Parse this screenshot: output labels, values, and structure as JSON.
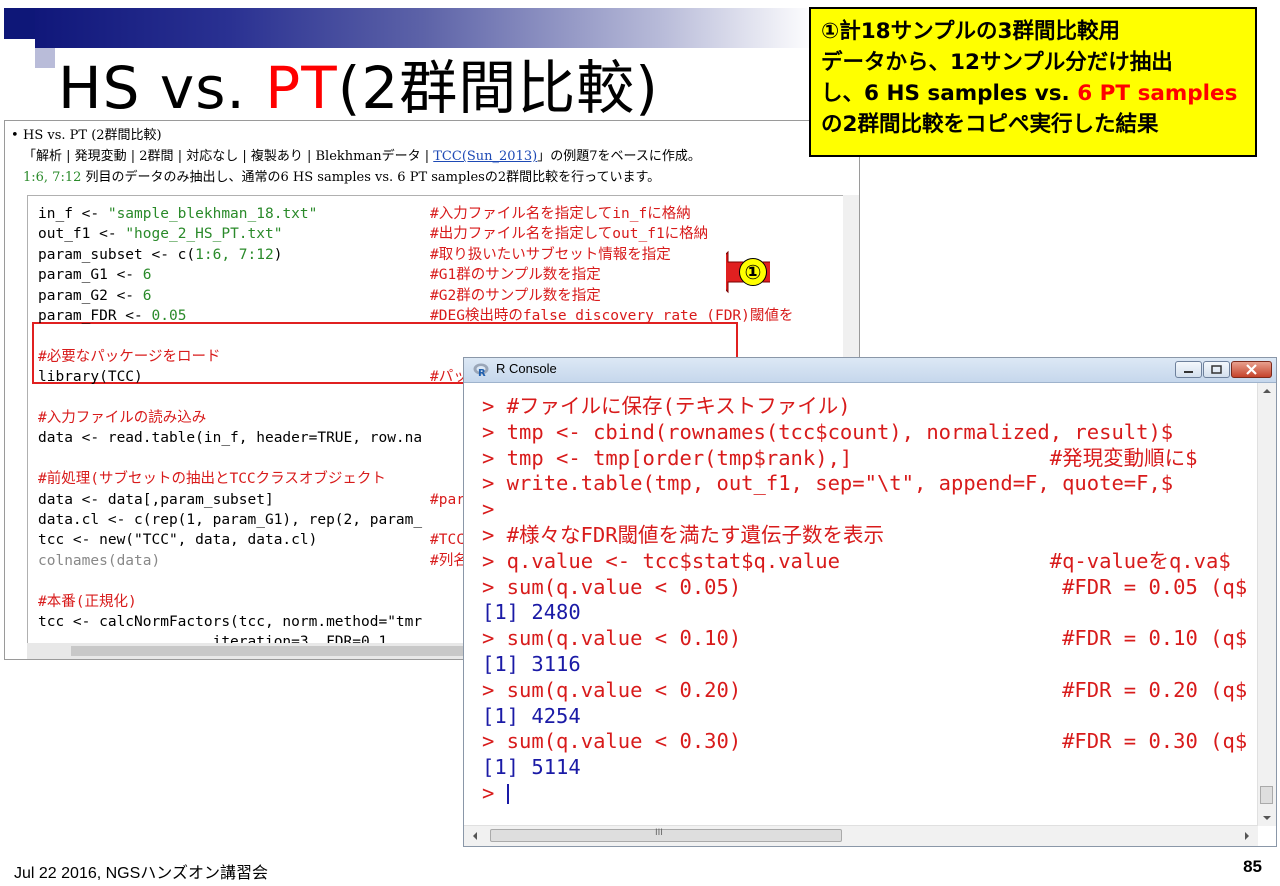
{
  "slide": {
    "title_prefix": "HS vs. ",
    "title_highlight": "PT",
    "title_suffix": "(2群間比較)",
    "footer_left": "Jul 22 2016, NGSハンズオン講習会",
    "page_number": "85"
  },
  "callout": {
    "line1": "①計18サンプルの3群間比較用",
    "line2": "データから、12サンプル分だけ抽出",
    "line3_a": "し、6 HS samples vs. ",
    "line3_red": "6 PT samples",
    "line4": "の2群間比較をコピペ実行した結果"
  },
  "doc": {
    "bullet": "•",
    "heading": "HS vs. PT (2群間比較)",
    "desc1_a": "「解析 | 発現変動 | 2群間 | 対応なし | 複製あり | Blekhmanデータ | ",
    "desc1_link": "TCC(Sun_2013)",
    "desc1_b": "」の例題7をベースに作成。",
    "desc2_ver": "1:6, 7:12",
    "desc2_b": " 列目のデータのみ抽出し、通常の6 HS samples vs. 6 PT samplesの2群間比較を行っています。"
  },
  "code": {
    "lines": [
      {
        "a": "in_f <- ",
        "s": "\"sample_blekhman_18.txt\"",
        "c": "#入力ファイル名を指定してin_fに格納"
      },
      {
        "a": "out_f1 <- ",
        "s": "\"hoge_2_HS_PT.txt\"",
        "c": "#出力ファイル名を指定してout_f1に格納"
      },
      {
        "a": "param_subset <- c(",
        "s": "1:6, 7:12",
        "b": ")",
        "c": "#取り扱いたいサブセット情報を指定"
      },
      {
        "a": "param_G1 <- ",
        "s": "6",
        "c": "#G1群のサンプル数を指定"
      },
      {
        "a": "param_G2 <- ",
        "s": "6",
        "c": "#G2群のサンプル数を指定"
      },
      {
        "a": "param_FDR <- ",
        "s": "0.05",
        "c": "#DEG検出時のfalse discovery rate (FDR)閾値を"
      },
      {
        "a": "",
        "c": ""
      },
      {
        "a": "",
        "cl": "#必要なパッケージをロード"
      },
      {
        "a": "library(TCC)",
        "c": "#パッ"
      },
      {
        "a": "",
        "c": ""
      },
      {
        "a": "",
        "cl": "#入力ファイルの読み込み"
      },
      {
        "a": "data <- read.table(in_f, header=TRUE, row.na",
        "c": ""
      },
      {
        "a": "",
        "c": ""
      },
      {
        "a": "",
        "cl": "#前処理(サブセットの抽出とTCCクラスオブジェクト"
      },
      {
        "a": "data <- data[,param_subset]",
        "c": "#para"
      },
      {
        "a": "data.cl <- c(rep(1, param_G1), rep(2, param_",
        "c": ""
      },
      {
        "a": "tcc <- new(\"TCC\", data, data.cl)",
        "c": "#TCC"
      },
      {
        "d": "colnames(data)",
        "c": "#列名"
      },
      {
        "a": "",
        "c": ""
      },
      {
        "a": "",
        "cl": "#本番(正規化)"
      },
      {
        "a": "tcc <- calcNormFactors(tcc, norm.method=\"tmr",
        "c": ""
      },
      {
        "a": "                    iteration=3, FDR=0.1,",
        "c": ""
      }
    ],
    "marker": "①"
  },
  "console": {
    "title": "R Console",
    "lines": [
      {
        "t": "> #ファイルに保存(テキストファイル)",
        "out": false
      },
      {
        "t": "> tmp <- cbind(rownames(tcc$count), normalized, result)$",
        "out": false
      },
      {
        "t": "> tmp <- tmp[order(tmp$rank),]                #発現変動順に$",
        "out": false
      },
      {
        "t": "> write.table(tmp, out_f1, sep=\"\\t\", append=F, quote=F,$",
        "out": false
      },
      {
        "t": ">",
        "out": false
      },
      {
        "t": "> #様々なFDR閾値を満たす遺伝子数を表示",
        "out": false
      },
      {
        "t": "> q.value <- tcc$stat$q.value                 #q-valueをq.va$",
        "out": false
      },
      {
        "t": "> sum(q.value < 0.05)                          #FDR = 0.05 (q$",
        "out": false
      },
      {
        "t": "[1] 2480",
        "out": true
      },
      {
        "t": "> sum(q.value < 0.10)                          #FDR = 0.10 (q$",
        "out": false
      },
      {
        "t": "[1] 3116",
        "out": true
      },
      {
        "t": "> sum(q.value < 0.20)                          #FDR = 0.20 (q$",
        "out": false
      },
      {
        "t": "[1] 4254",
        "out": true
      },
      {
        "t": "> sum(q.value < 0.30)                          #FDR = 0.30 (q$",
        "out": false
      },
      {
        "t": "[1] 5114",
        "out": true
      }
    ],
    "prompt": "> ",
    "hscroll_mark": "III"
  }
}
